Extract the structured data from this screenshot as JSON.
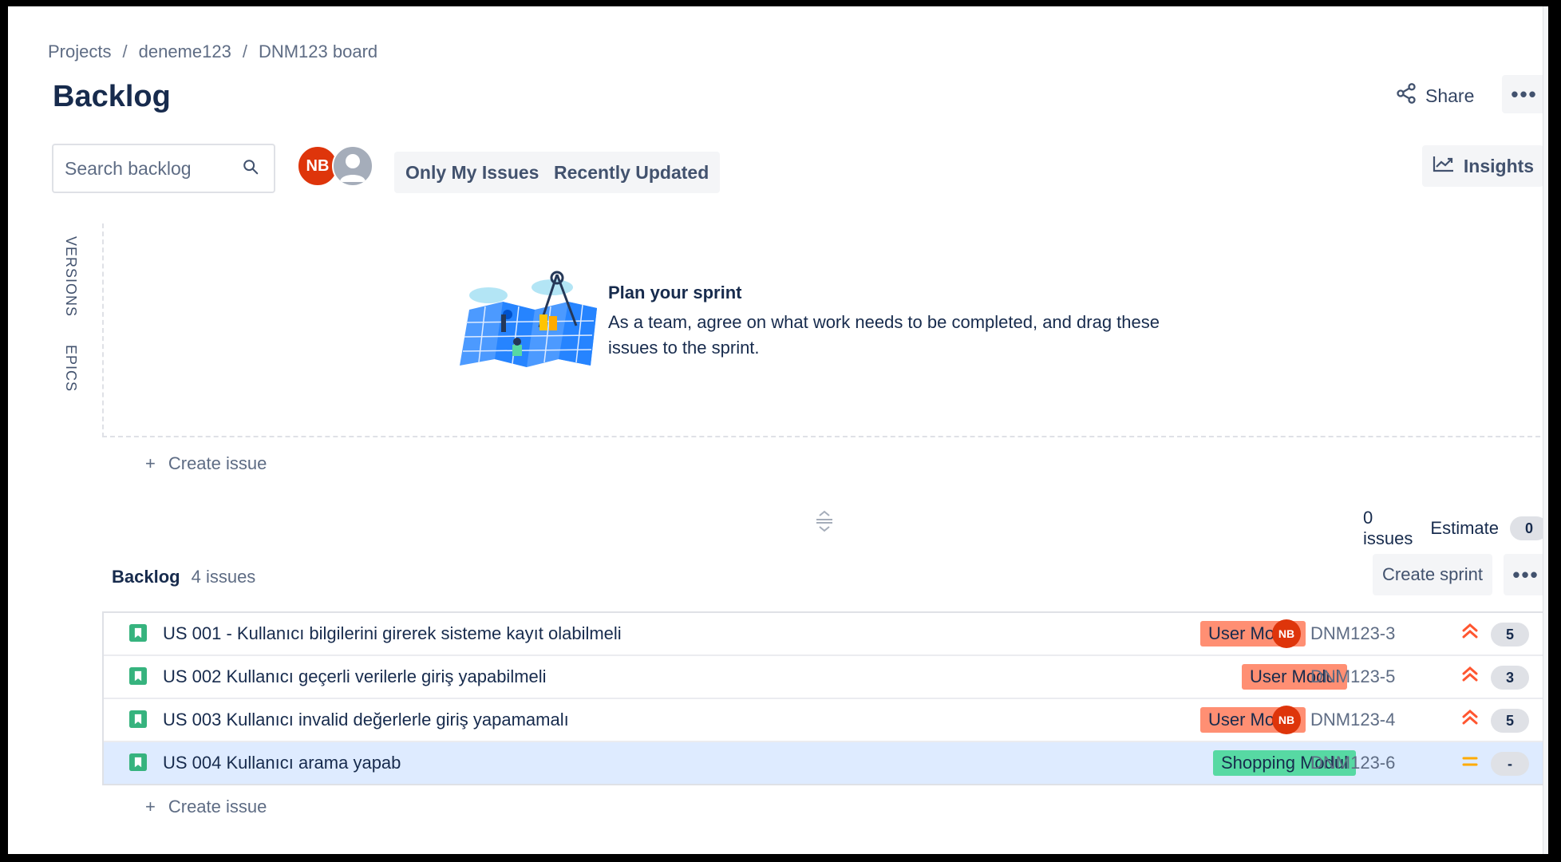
{
  "breadcrumb": {
    "items": [
      "Projects",
      "deneme123",
      "DNM123 board"
    ],
    "separator": "/"
  },
  "page": {
    "title": "Backlog"
  },
  "header_actions": {
    "share_label": "Share",
    "more_label": "•••"
  },
  "toolbar": {
    "search_placeholder": "Search backlog",
    "avatar_initials": "NB",
    "only_my_issues": "Only My Issues",
    "recently_updated": "Recently Updated",
    "insights_label": "Insights"
  },
  "side_panel": {
    "versions": "VERSIONS",
    "epics": "EPICS"
  },
  "sprint": {
    "plan_title": "Plan your sprint",
    "plan_description": "As a team, agree on what work needs to be completed, and drag these issues to the sprint.",
    "create_issue": "Create issue",
    "create_issue_plus": "+",
    "issues_count": "0 issues",
    "estimate_label": "Estimate",
    "estimate_value": "0"
  },
  "backlog": {
    "title": "Backlog",
    "count": "4 issues",
    "create_sprint": "Create sprint",
    "more_label": "•••",
    "create_issue": "Create issue",
    "create_issue_plus": "+",
    "issues": [
      {
        "summary": "US 001 - Kullanıcı bilgilerini girerek sisteme kayıt olabilmeli",
        "label": "User Modul",
        "label_type": "user",
        "assignee": "NB",
        "key": "DNM123-3",
        "priority": "high",
        "estimate": "5"
      },
      {
        "summary": "US 002 Kullanıcı geçerli verilerle giriş yapabilmeli",
        "label": "User Modul",
        "label_type": "user",
        "assignee": "",
        "key": "DNM123-5",
        "priority": "high",
        "estimate": "3"
      },
      {
        "summary": "US 003 Kullanıcı invalid değerlerle giriş yapamamalı",
        "label": "User Modul",
        "label_type": "user",
        "assignee": "NB",
        "key": "DNM123-4",
        "priority": "high",
        "estimate": "5"
      },
      {
        "summary": "US 004 Kullanıcı arama yapab",
        "label": "Shopping Modul",
        "label_type": "shop",
        "assignee": "",
        "key": "DNM123-6",
        "priority": "medium",
        "estimate": "-"
      }
    ]
  },
  "colors": {
    "story_icon": "#36b37e",
    "priority_high": "#ff5630",
    "priority_medium": "#ffab00",
    "selected_row": "#deebff",
    "avatar_nb": "#de350b"
  }
}
